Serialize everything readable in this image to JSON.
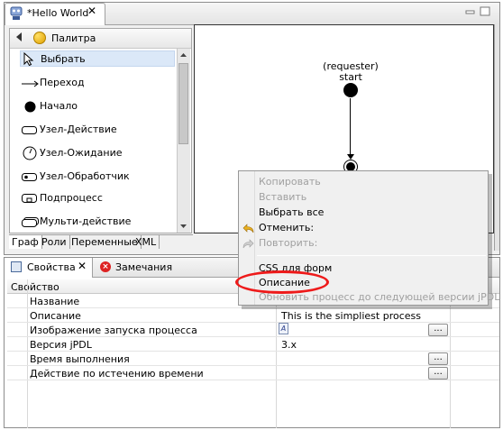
{
  "editor": {
    "tab_title": "*Hello World",
    "close_glyph": "✕"
  },
  "palette": {
    "title": "Палитра",
    "items": [
      {
        "label": "Выбрать",
        "icon": "pointer-icon"
      },
      {
        "label": "Переход",
        "icon": "arrow-right-icon"
      },
      {
        "label": "Начало",
        "icon": "filled-circle-icon"
      },
      {
        "label": "Узел-Действие",
        "icon": "rounded-rect-icon"
      },
      {
        "label": "Узел-Ожидание",
        "icon": "clock-icon"
      },
      {
        "label": "Узел-Обработчик",
        "icon": "handler-icon"
      },
      {
        "label": "Подпроцесс",
        "icon": "subprocess-icon"
      },
      {
        "label": "Мульти-действие",
        "icon": "multi-action-icon"
      }
    ]
  },
  "bottom_tabs": [
    "Граф",
    "Роли",
    "Переменные",
    "XML"
  ],
  "diagram": {
    "start_role": "(requester)",
    "start_name": "start"
  },
  "properties": {
    "tab_label": "Свойства",
    "tab2_label": "Замечания",
    "column_header": "Свойство",
    "ellipsis_label": "...",
    "file_icon_glyph": "A",
    "rows": [
      {
        "name": "Название",
        "value": ""
      },
      {
        "name": "Описание",
        "value": "This is the simpliest process"
      },
      {
        "name": "Изображение запуска процесса",
        "value": ""
      },
      {
        "name": "Версия jPDL",
        "value": "3.x"
      },
      {
        "name": "Время выполнения",
        "value": ""
      },
      {
        "name": "Действие по истечению времени",
        "value": ""
      }
    ]
  },
  "context_menu": {
    "items": [
      {
        "label": "Копировать",
        "enabled": false
      },
      {
        "label": "Вставить",
        "enabled": false
      },
      {
        "label": "Выбрать все",
        "enabled": true
      },
      {
        "label": "Отменить:",
        "enabled": true
      },
      {
        "label": "Повторить:",
        "enabled": false
      },
      {
        "label": "CSS для форм",
        "enabled": true
      },
      {
        "label": "Описание",
        "enabled": true
      },
      {
        "label": "Обновить процесс до следующей версии jPDL",
        "enabled": false
      }
    ]
  },
  "colors": {
    "highlight": "#ee1a1a",
    "selection": "#dbe8f8"
  }
}
